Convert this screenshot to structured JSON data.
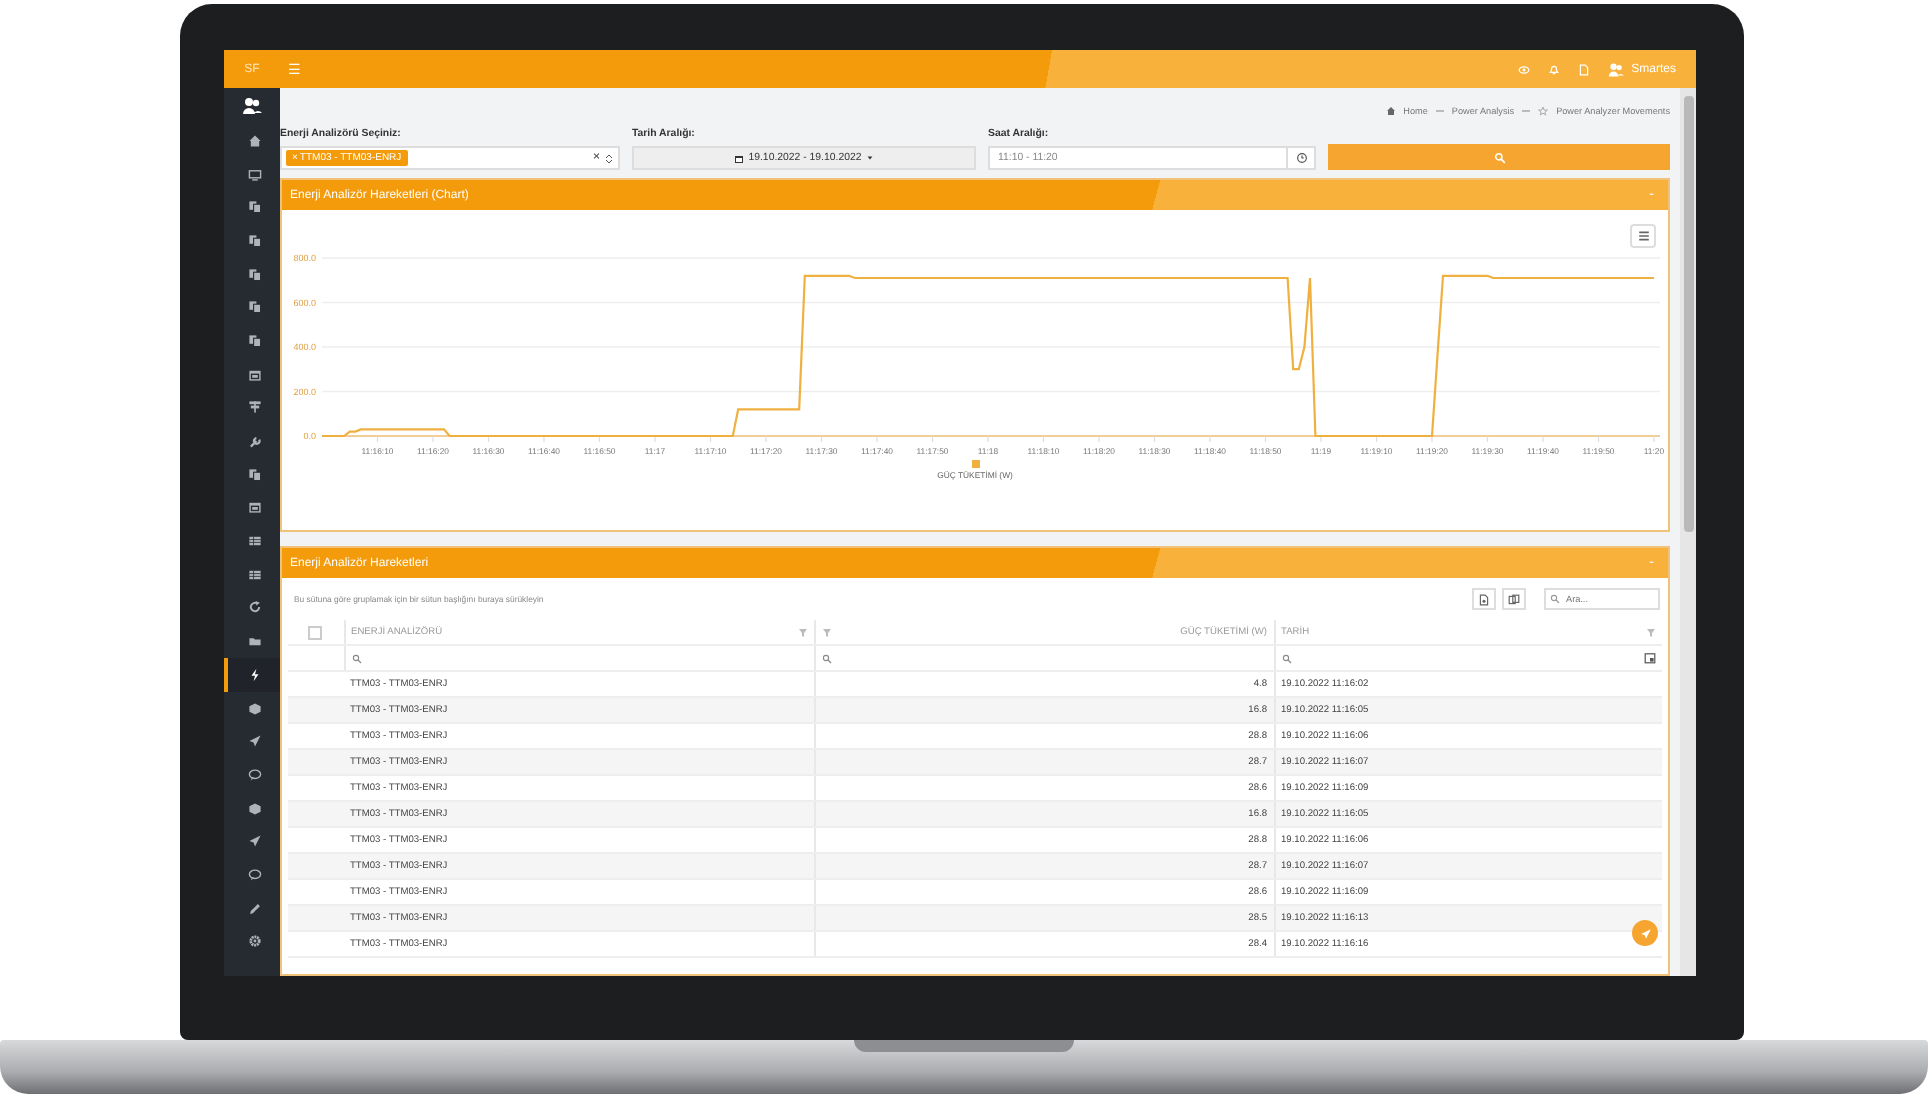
{
  "topbar": {
    "logo": "SF",
    "menu": "☰",
    "user": "Smartes"
  },
  "sidebar": {
    "items": [
      {
        "kind": "home",
        "selected": false
      },
      {
        "kind": "monitor",
        "selected": false
      },
      {
        "kind": "copy",
        "selected": false
      },
      {
        "kind": "copy",
        "selected": false
      },
      {
        "kind": "copy",
        "selected": false
      },
      {
        "kind": "copy",
        "selected": false
      },
      {
        "kind": "copy",
        "selected": false
      },
      {
        "kind": "calendar",
        "selected": false
      },
      {
        "kind": "signpost",
        "selected": false
      },
      {
        "kind": "wrench",
        "selected": false
      },
      {
        "kind": "copy",
        "selected": false
      },
      {
        "kind": "calendar",
        "selected": false
      },
      {
        "kind": "table",
        "selected": false
      },
      {
        "kind": "table",
        "selected": false
      },
      {
        "kind": "refresh",
        "selected": false
      },
      {
        "kind": "folder",
        "selected": false
      },
      {
        "kind": "bolt",
        "selected": true
      },
      {
        "kind": "cube",
        "selected": false
      },
      {
        "kind": "send",
        "selected": false
      },
      {
        "kind": "chat",
        "selected": false
      },
      {
        "kind": "cube",
        "selected": false
      },
      {
        "kind": "send",
        "selected": false
      },
      {
        "kind": "chat",
        "selected": false
      },
      {
        "kind": "pencil",
        "selected": false
      },
      {
        "kind": "gear",
        "selected": false
      }
    ]
  },
  "breadcrumb": [
    "Home",
    "Power Analysis",
    "Power Analyzer Movements"
  ],
  "filters": {
    "analyzer": {
      "label": "Enerji Analizörü Seçiniz:",
      "tag": "TTM03 - TTM03-ENRJ",
      "remove": "×",
      "clear": "×"
    },
    "date": {
      "label": "Tarih Aralığı:",
      "value": "19.10.2022 - 19.10.2022"
    },
    "time": {
      "label": "Saat Aralığı:",
      "value": "11:10 - 11:20"
    }
  },
  "chart_panel": {
    "title": "Enerji Analizör Hareketleri (Chart)",
    "collapse": "-",
    "chart_data": {
      "type": "line",
      "categories": [
        null,
        null,
        null,
        null,
        null,
        null,
        null,
        null,
        null,
        null,
        "11:16:10",
        null,
        null,
        null,
        null,
        null,
        null,
        null,
        null,
        null,
        "11:16:20",
        null,
        null,
        null,
        null,
        null,
        null,
        null,
        null,
        null,
        "11:16:30",
        null,
        null,
        null,
        null,
        null,
        null,
        null,
        null,
        null,
        "11:16:40",
        null,
        null,
        null,
        null,
        null,
        null,
        null,
        null,
        null,
        "11:16:50",
        null,
        null,
        null,
        null,
        null,
        null,
        null,
        null,
        null,
        "11:17",
        null,
        null,
        null,
        null,
        null,
        null,
        null,
        null,
        null,
        "11:17:10",
        null,
        null,
        null,
        null,
        null,
        null,
        null,
        null,
        null,
        "11:17:20",
        null,
        null,
        null,
        null,
        null,
        null,
        null,
        null,
        null,
        "11:17:30",
        null,
        null,
        null,
        null,
        null,
        null,
        null,
        null,
        null,
        "11:17:40",
        null,
        null,
        null,
        null,
        null,
        null,
        null,
        null,
        null,
        "11:17:50",
        null,
        null,
        null,
        null,
        null,
        null,
        null,
        null,
        null,
        "11:18",
        null,
        null,
        null,
        null,
        null,
        null,
        null,
        null,
        null,
        "11:18:10",
        null,
        null,
        null,
        null,
        null,
        null,
        null,
        null,
        null,
        "11:18:20",
        null,
        null,
        null,
        null,
        null,
        null,
        null,
        null,
        null,
        "11:18:30",
        null,
        null,
        null,
        null,
        null,
        null,
        null,
        null,
        null,
        "11:18:40",
        null,
        null,
        null,
        null,
        null,
        null,
        null,
        null,
        null,
        "11:18:50",
        null,
        null,
        null,
        null,
        null,
        null,
        null,
        null,
        null,
        "11:19",
        null,
        null,
        null,
        null,
        null,
        null,
        null,
        null,
        null,
        "11:19:10",
        null,
        null,
        null,
        null,
        null,
        null,
        null,
        null,
        null,
        "11:19:20",
        null,
        null,
        null,
        null,
        null,
        null,
        null,
        null,
        null,
        "11:19:30",
        null,
        null,
        null,
        null,
        null,
        null,
        null,
        null,
        null,
        "11:19:40",
        null,
        null,
        null,
        null,
        null,
        null,
        null,
        null,
        null,
        "11:19:50",
        null,
        null,
        null,
        null,
        null,
        null,
        null,
        null,
        null,
        "11:20"
      ],
      "series": [
        {
          "name": "GÜÇ TÜKETİMİ (W)",
          "color": "#f0b040",
          "values": [
            0,
            0,
            0,
            0,
            0,
            20,
            20,
            30,
            30,
            30,
            30,
            30,
            30,
            30,
            30,
            30,
            30,
            30,
            30,
            30,
            30,
            30,
            30,
            0,
            0,
            0,
            0,
            0,
            0,
            0,
            0,
            0,
            0,
            0,
            0,
            0,
            0,
            0,
            0,
            0,
            0,
            0,
            0,
            0,
            0,
            0,
            0,
            0,
            0,
            0,
            0,
            0,
            0,
            0,
            0,
            0,
            0,
            0,
            0,
            0,
            0,
            0,
            0,
            0,
            0,
            0,
            0,
            0,
            0,
            0,
            0,
            0,
            0,
            0,
            0,
            120,
            120,
            120,
            120,
            120,
            120,
            120,
            120,
            120,
            120,
            120,
            120,
            720,
            720,
            720,
            720,
            720,
            720,
            720,
            720,
            720,
            710,
            710,
            710,
            710,
            710,
            710,
            710,
            710,
            710,
            710,
            710,
            710,
            710,
            710,
            710,
            710,
            710,
            710,
            710,
            710,
            710,
            710,
            710,
            710,
            710,
            710,
            710,
            710,
            710,
            710,
            710,
            710,
            710,
            710,
            710,
            710,
            710,
            710,
            710,
            710,
            710,
            710,
            710,
            710,
            710,
            710,
            710,
            710,
            710,
            710,
            710,
            710,
            710,
            710,
            710,
            710,
            710,
            710,
            710,
            710,
            710,
            710,
            710,
            710,
            710,
            710,
            710,
            710,
            710,
            710,
            710,
            710,
            710,
            710,
            710,
            710,
            710,
            710,
            710,
            300,
            300,
            400,
            710,
            0,
            0,
            0,
            0,
            0,
            0,
            0,
            0,
            0,
            0,
            0,
            0,
            0,
            0,
            0,
            0,
            0,
            0,
            0,
            0,
            0,
            0,
            370,
            720,
            720,
            720,
            720,
            720,
            720,
            720,
            720,
            720,
            710,
            710,
            710,
            710,
            710,
            710,
            710,
            710,
            710,
            710,
            710,
            710,
            710,
            710,
            710,
            710,
            710,
            710,
            710,
            710,
            710,
            710,
            710,
            710,
            710,
            710,
            710,
            710,
            710,
            710
          ]
        }
      ],
      "ylim": [
        0,
        800
      ],
      "grid": true,
      "yticks": [
        {
          "value": 0,
          "label": "0.0"
        },
        {
          "value": 200,
          "label": "200.0"
        },
        {
          "value": 400,
          "label": "400.0"
        },
        {
          "value": 600,
          "label": "600.0"
        },
        {
          "value": 800,
          "label": "800.0"
        }
      ]
    }
  },
  "table_panel": {
    "title": "Enerji Analizör Hareketleri",
    "collapse": "-",
    "group_hint": "Bu sütuna göre gruplamak için bir sütun başlığını buraya sürükleyin",
    "search_placeholder": "Ara...",
    "select_all_checked": false,
    "columns": [
      "ENERJİ ANALİZÖRÜ",
      "GÜÇ TÜKETİMİ (W)",
      "TARİH"
    ],
    "rows": [
      {
        "analyzer": "TTM03 - TTM03-ENRJ",
        "power": "4.8",
        "date": "19.10.2022 11:16:02"
      },
      {
        "analyzer": "TTM03 - TTM03-ENRJ",
        "power": "16.8",
        "date": "19.10.2022 11:16:05"
      },
      {
        "analyzer": "TTM03 - TTM03-ENRJ",
        "power": "28.8",
        "date": "19.10.2022 11:16:06"
      },
      {
        "analyzer": "TTM03 - TTM03-ENRJ",
        "power": "28.7",
        "date": "19.10.2022 11:16:07"
      },
      {
        "analyzer": "TTM03 - TTM03-ENRJ",
        "power": "28.6",
        "date": "19.10.2022 11:16:09"
      },
      {
        "analyzer": "TTM03 - TTM03-ENRJ",
        "power": "16.8",
        "date": "19.10.2022 11:16:05"
      },
      {
        "analyzer": "TTM03 - TTM03-ENRJ",
        "power": "28.8",
        "date": "19.10.2022 11:16:06"
      },
      {
        "analyzer": "TTM03 - TTM03-ENRJ",
        "power": "28.7",
        "date": "19.10.2022 11:16:07"
      },
      {
        "analyzer": "TTM03 - TTM03-ENRJ",
        "power": "28.6",
        "date": "19.10.2022 11:16:09"
      },
      {
        "analyzer": "TTM03 - TTM03-ENRJ",
        "power": "28.5",
        "date": "19.10.2022 11:16:13"
      },
      {
        "analyzer": "TTM03 - TTM03-ENRJ",
        "power": "28.4",
        "date": "19.10.2022 11:16:16"
      }
    ]
  }
}
